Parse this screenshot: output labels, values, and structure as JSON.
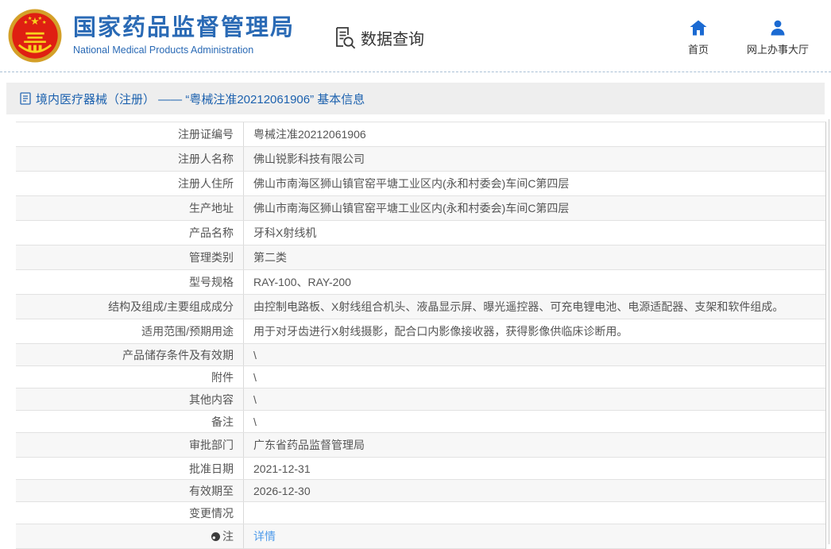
{
  "header": {
    "brand": {
      "title_cn": "国家药品监督管理局",
      "title_en": "National Medical Products Administration"
    },
    "data_query_label": "数据查询",
    "nav": [
      {
        "label": "首页",
        "icon": "home-icon"
      },
      {
        "label": "网上办事大厅",
        "icon": "user-icon"
      }
    ]
  },
  "page": {
    "title": "境内医疗器械（注册） —— “粤械注准20212061906” 基本信息"
  },
  "table": {
    "rows": [
      {
        "label": "注册证编号",
        "value": "粤械注准20212061906"
      },
      {
        "label": "注册人名称",
        "value": "佛山锐影科技有限公司"
      },
      {
        "label": "注册人住所",
        "value": "佛山市南海区狮山镇官窑平塘工业区内(永和村委会)车间C第四层"
      },
      {
        "label": "生产地址",
        "value": "佛山市南海区狮山镇官窑平塘工业区内(永和村委会)车间C第四层"
      },
      {
        "label": "产品名称",
        "value": "牙科X射线机"
      },
      {
        "label": "管理类别",
        "value": "第二类"
      },
      {
        "label": "型号规格",
        "value": "RAY-100、RAY-200"
      },
      {
        "label": "结构及组成/主要组成成分",
        "value": "由控制电路板、X射线组合机头、液晶显示屏、曝光遥控器、可充电锂电池、电源适配器、支架和软件组成。"
      },
      {
        "label": "适用范围/预期用途",
        "value": "用于对牙齿进行X射线摄影，配合口内影像接收器，获得影像供临床诊断用。"
      },
      {
        "label": "产品储存条件及有效期",
        "value": "\\"
      },
      {
        "label": "附件",
        "value": "\\"
      },
      {
        "label": "其他内容",
        "value": "\\"
      },
      {
        "label": "备注",
        "value": "\\"
      },
      {
        "label": "审批部门",
        "value": "广东省药品监督管理局"
      },
      {
        "label": "批准日期",
        "value": "2021-12-31"
      },
      {
        "label": "有效期至",
        "value": "2026-12-30"
      },
      {
        "label": "变更情况",
        "value": ""
      },
      {
        "label": "注",
        "label_icon": "note-icon",
        "value": "详情",
        "value_type": "link"
      }
    ]
  },
  "colors": {
    "brand_blue": "#2a6ab5",
    "page_title_blue": "#1c61ae",
    "link_blue": "#4f9bea",
    "nav_icon_blue": "#1b6ad2",
    "emblem_red": "#df1f12",
    "emblem_gold": "#f7d11e"
  }
}
